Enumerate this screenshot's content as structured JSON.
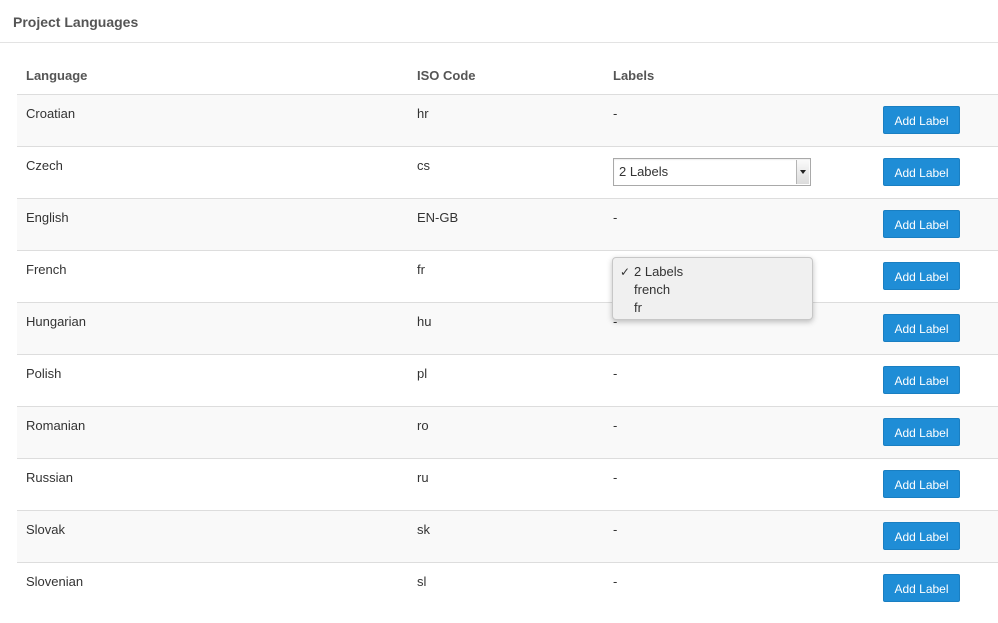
{
  "header": {
    "title": "Project Languages"
  },
  "table": {
    "columns": [
      "Language",
      "ISO Code",
      "Labels",
      ""
    ],
    "rows": [
      {
        "language": "Croatian",
        "iso": "hr",
        "labels": "-",
        "action": "Add Label"
      },
      {
        "language": "Czech",
        "iso": "cs",
        "labels": "2 Labels",
        "action": "Add Label"
      },
      {
        "language": "English",
        "iso": "EN-GB",
        "labels": "-",
        "action": "Add Label"
      },
      {
        "language": "French",
        "iso": "fr",
        "labels": "",
        "action": "Add Label"
      },
      {
        "language": "Hungarian",
        "iso": "hu",
        "labels": "-",
        "action": "Add Label"
      },
      {
        "language": "Polish",
        "iso": "pl",
        "labels": "-",
        "action": "Add Label"
      },
      {
        "language": "Romanian",
        "iso": "ro",
        "labels": "-",
        "action": "Add Label"
      },
      {
        "language": "Russian",
        "iso": "ru",
        "labels": "-",
        "action": "Add Label"
      },
      {
        "language": "Slovak",
        "iso": "sk",
        "labels": "-",
        "action": "Add Label"
      },
      {
        "language": "Slovenian",
        "iso": "sl",
        "labels": "-",
        "action": "Add Label"
      }
    ]
  },
  "labels_dropdown": {
    "selected": "2 Labels",
    "check_glyph": "✓",
    "options": [
      "2 Labels",
      "french",
      "fr"
    ]
  },
  "colors": {
    "button_bg": "#1f8dd6",
    "button_text": "#ffffff",
    "stripe": "#f9f9f9"
  }
}
